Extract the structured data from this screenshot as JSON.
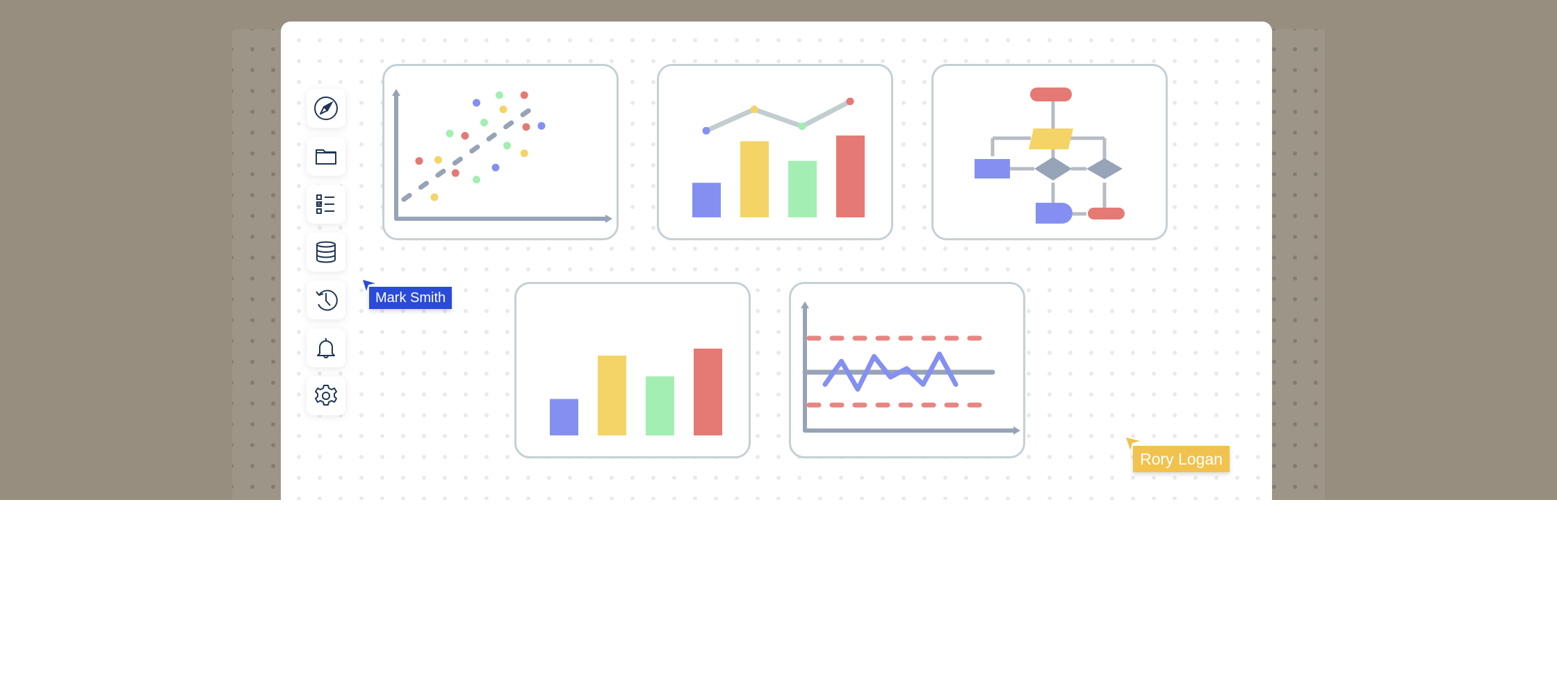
{
  "colors": {
    "backdrop": "#978e80",
    "board": "#ffffff",
    "card_border": "#c5d0d4",
    "axis": "#97a3b6",
    "blue": "#8490f1",
    "yellow": "#f4d466",
    "green": "#a3eeb3",
    "red": "#e57973",
    "trend_line": "#c2cdd0",
    "icon_stroke": "#1f3550"
  },
  "toolbar": {
    "items": [
      {
        "name": "explore",
        "icon": "compass-icon"
      },
      {
        "name": "files",
        "icon": "folder-icon"
      },
      {
        "name": "tasks",
        "icon": "checklist-icon"
      },
      {
        "name": "database",
        "icon": "database-icon"
      },
      {
        "name": "history",
        "icon": "history-icon"
      },
      {
        "name": "notifications",
        "icon": "bell-icon"
      },
      {
        "name": "settings",
        "icon": "gear-icon"
      }
    ]
  },
  "collaborators": [
    {
      "name": "Mark Smith",
      "color": "#2a4bd8"
    },
    {
      "name": "Rory Logan",
      "color": "#f1c24d"
    }
  ],
  "cards": {
    "scatter": {
      "kind": "scatter-with-trendline",
      "points": [
        {
          "x": 0.12,
          "y": 0.4,
          "c": "red"
        },
        {
          "x": 0.22,
          "y": 0.41,
          "c": "yellow"
        },
        {
          "x": 0.2,
          "y": 0.07,
          "c": "yellow"
        },
        {
          "x": 0.31,
          "y": 0.29,
          "c": "red"
        },
        {
          "x": 0.28,
          "y": 0.65,
          "c": "green"
        },
        {
          "x": 0.36,
          "y": 0.63,
          "c": "red"
        },
        {
          "x": 0.42,
          "y": 0.23,
          "c": "green"
        },
        {
          "x": 0.42,
          "y": 0.93,
          "c": "blue"
        },
        {
          "x": 0.46,
          "y": 0.75,
          "c": "green"
        },
        {
          "x": 0.52,
          "y": 0.34,
          "c": "blue"
        },
        {
          "x": 0.54,
          "y": 1.0,
          "c": "green"
        },
        {
          "x": 0.56,
          "y": 0.87,
          "c": "yellow"
        },
        {
          "x": 0.58,
          "y": 0.54,
          "c": "green"
        },
        {
          "x": 0.67,
          "y": 1.0,
          "c": "red"
        },
        {
          "x": 0.67,
          "y": 0.47,
          "c": "yellow"
        },
        {
          "x": 0.68,
          "y": 0.71,
          "c": "red"
        },
        {
          "x": 0.76,
          "y": 0.72,
          "c": "blue"
        }
      ],
      "trend": {
        "from": [
          0.04,
          0.05
        ],
        "to": [
          0.75,
          0.93
        ]
      }
    },
    "bar_line": {
      "kind": "bar-with-line",
      "bars": [
        {
          "value": 0.3,
          "c": "blue"
        },
        {
          "value": 0.66,
          "c": "yellow"
        },
        {
          "value": 0.49,
          "c": "green"
        },
        {
          "value": 0.71,
          "c": "red"
        }
      ],
      "line": [
        {
          "value": 0.67,
          "c": "blue"
        },
        {
          "value": 0.91,
          "c": "yellow"
        },
        {
          "value": 0.72,
          "c": "green"
        },
        {
          "value": 1.0,
          "c": "red"
        }
      ]
    },
    "flowchart": {
      "kind": "flowchart",
      "nodes": [
        {
          "id": "start",
          "shape": "terminator",
          "c": "red"
        },
        {
          "id": "input",
          "shape": "parallelogram",
          "c": "yellow"
        },
        {
          "id": "process",
          "shape": "rectangle",
          "c": "blue"
        },
        {
          "id": "decision-1",
          "shape": "diamond",
          "c": "axis"
        },
        {
          "id": "decision-2",
          "shape": "diamond",
          "c": "axis"
        },
        {
          "id": "delay",
          "shape": "delay",
          "c": "blue"
        },
        {
          "id": "end",
          "shape": "terminator",
          "c": "red"
        }
      ]
    },
    "bar": {
      "kind": "bar",
      "bars": [
        {
          "value": 0.42,
          "c": "blue"
        },
        {
          "value": 0.92,
          "c": "yellow"
        },
        {
          "value": 0.68,
          "c": "green"
        },
        {
          "value": 1.0,
          "c": "red"
        }
      ]
    },
    "control": {
      "kind": "control-chart",
      "upper_limit": 0.76,
      "center": 0.48,
      "lower_limit": 0.21,
      "series": [
        0.38,
        0.57,
        0.34,
        0.61,
        0.44,
        0.51,
        0.38,
        0.63,
        0.38
      ]
    }
  }
}
